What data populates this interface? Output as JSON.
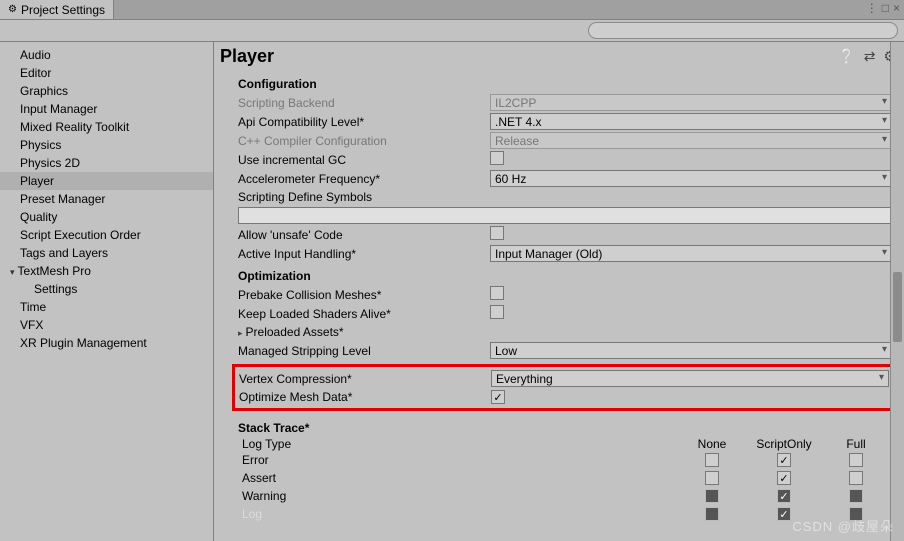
{
  "tab": {
    "title": "Project Settings"
  },
  "winButtons": {
    "min": "⋮",
    "max": "□",
    "close": "×"
  },
  "sidebar": {
    "items": [
      {
        "label": "Audio"
      },
      {
        "label": "Editor"
      },
      {
        "label": "Graphics"
      },
      {
        "label": "Input Manager"
      },
      {
        "label": "Mixed Reality Toolkit"
      },
      {
        "label": "Physics"
      },
      {
        "label": "Physics 2D"
      },
      {
        "label": "Player",
        "selected": true
      },
      {
        "label": "Preset Manager"
      },
      {
        "label": "Quality"
      },
      {
        "label": "Script Execution Order"
      },
      {
        "label": "Tags and Layers"
      },
      {
        "label": "TextMesh Pro",
        "group": true,
        "children": [
          {
            "label": "Settings"
          }
        ]
      },
      {
        "label": "Time"
      },
      {
        "label": "VFX"
      },
      {
        "label": "XR Plugin Management"
      }
    ]
  },
  "content": {
    "title": "Player",
    "sections": {
      "configuration": {
        "heading": "Configuration",
        "scriptingBackend": {
          "label": "Scripting Backend",
          "value": "IL2CPP",
          "disabled": true
        },
        "apiCompat": {
          "label": "Api Compatibility Level*",
          "value": ".NET 4.x"
        },
        "cppCompiler": {
          "label": "C++ Compiler Configuration",
          "value": "Release",
          "disabled": true
        },
        "incrementalGC": {
          "label": "Use incremental GC",
          "checked": false
        },
        "accelerometer": {
          "label": "Accelerometer Frequency*",
          "value": "60 Hz"
        },
        "scriptingDefines": {
          "label": "Scripting Define Symbols"
        },
        "allowUnsafe": {
          "label": "Allow 'unsafe' Code",
          "checked": false
        },
        "activeInput": {
          "label": "Active Input Handling*",
          "value": "Input Manager (Old)"
        }
      },
      "optimization": {
        "heading": "Optimization",
        "prebake": {
          "label": "Prebake Collision Meshes*",
          "checked": false
        },
        "keepShaders": {
          "label": "Keep Loaded Shaders Alive*",
          "checked": false
        },
        "preloaded": {
          "label": "Preloaded Assets*"
        },
        "stripping": {
          "label": "Managed Stripping Level",
          "value": "Low"
        },
        "vertexCompression": {
          "label": "Vertex Compression*",
          "value": "Everything"
        },
        "optimizeMesh": {
          "label": "Optimize Mesh Data*",
          "checked": true
        }
      },
      "stackTrace": {
        "heading": "Stack Trace*",
        "cols": {
          "logtype": "Log Type",
          "none": "None",
          "scriptOnly": "ScriptOnly",
          "full": "Full"
        },
        "rows": [
          {
            "label": "Error",
            "none": false,
            "scriptOnly": true,
            "full": false
          },
          {
            "label": "Assert",
            "none": false,
            "scriptOnly": true,
            "full": false
          },
          {
            "label": "Warning",
            "none": false,
            "scriptOnly": true,
            "full": false
          },
          {
            "label": "Log",
            "none": false,
            "scriptOnly": true,
            "full": false
          }
        ]
      }
    }
  },
  "watermark": "CSDN @歧屋朵"
}
